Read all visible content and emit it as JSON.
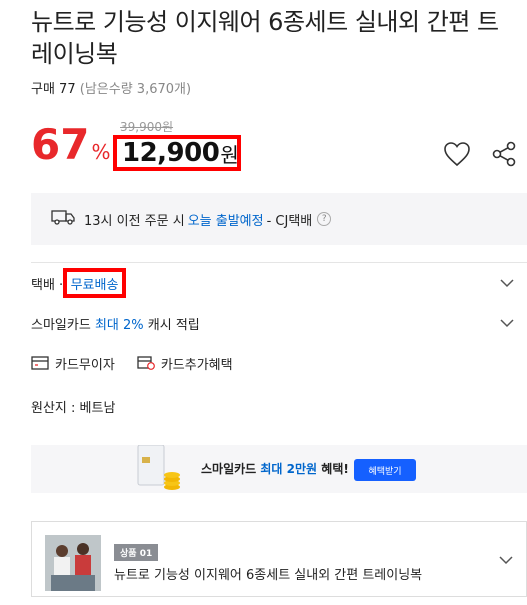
{
  "product": {
    "title": "뉴트로 기능성 이지웨어 6종세트 실내외 간편 트레이닝복",
    "purchase_label": "구매 77",
    "remaining": "(남은수량 3,670개)"
  },
  "price": {
    "discount": "67",
    "discount_unit": "%",
    "original": "39,900원",
    "sale": "12,900",
    "unit": "원"
  },
  "delivery": {
    "text1": "13시 이전 주문 시",
    "highlight": "오늘 출발예정",
    "text2": "- CJ택배",
    "help": "?"
  },
  "shipping": {
    "label": "택배 ·",
    "free": "무료배송"
  },
  "smilecard": {
    "prefix": "스마일카드",
    "highlight": "최대 2%",
    "suffix": "캐시 적립"
  },
  "card_options": {
    "installment": "카드무이자",
    "extra": "카드추가혜택"
  },
  "origin": "원산지 : 베트남",
  "banner": {
    "prefix": "스마일카드",
    "highlight": "최대 2만원",
    "suffix": "혜택!",
    "button": "혜택받기"
  },
  "option_product": {
    "badge": "상품 01",
    "name": "뉴트로 기능성 이지웨어 6종세트 실내외 간편 트레이닝복"
  },
  "colors": {
    "discount_red": "#e8282b",
    "link_blue": "#0066cc",
    "highlight_border": "#ff0000",
    "button_blue": "#1560ff"
  }
}
